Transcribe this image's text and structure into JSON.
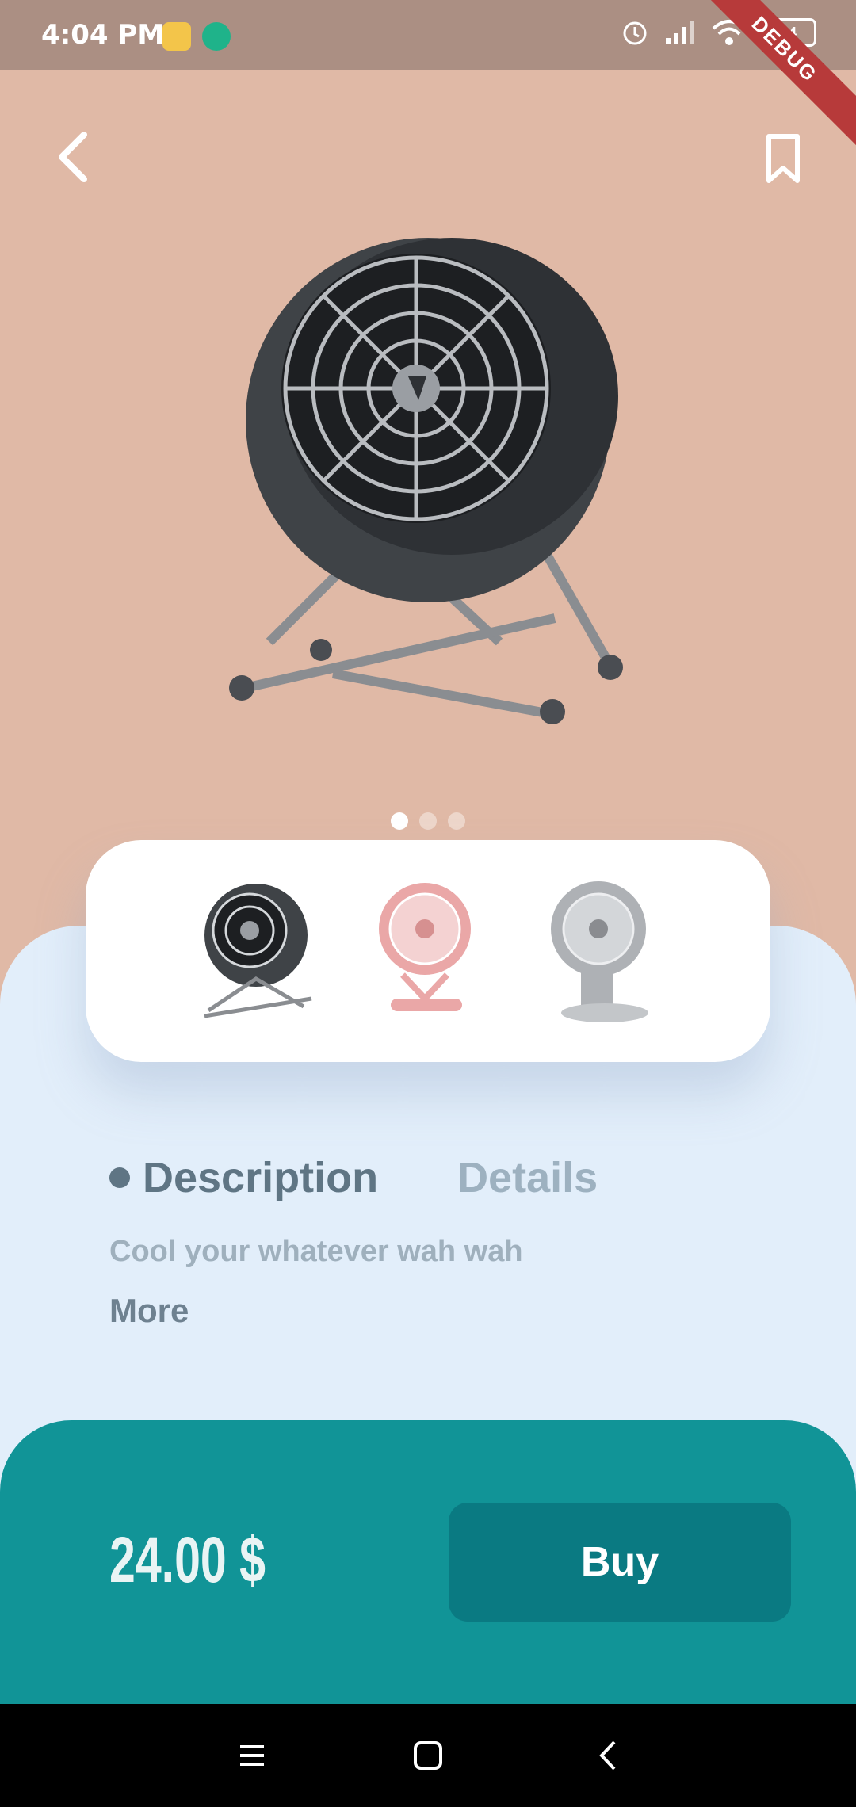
{
  "status_bar": {
    "time": "4:04 PM",
    "battery": "94",
    "debug_label": "DEBUG"
  },
  "product": {
    "image_icon": "desk-fan-illustration",
    "carousel_pages": 3,
    "carousel_current": 1,
    "thumbnails": [
      {
        "name": "dark-grey-fan",
        "color": "#3f4347"
      },
      {
        "name": "red-vintage-fan",
        "color": "#e48a8a"
      },
      {
        "name": "grey-pedestal-fan",
        "color": "#9a9ea3"
      }
    ]
  },
  "tabs": {
    "active": "Description",
    "inactive": "Details"
  },
  "description": {
    "text": "Cool your whatever wah wah",
    "more": "More"
  },
  "footer": {
    "price": "24.00 $",
    "buy_label": "Buy"
  },
  "colors": {
    "hero": "#e0b9a6",
    "sheet": "#e2eefa",
    "footer": "#119497",
    "buy": "#0a7a82"
  }
}
